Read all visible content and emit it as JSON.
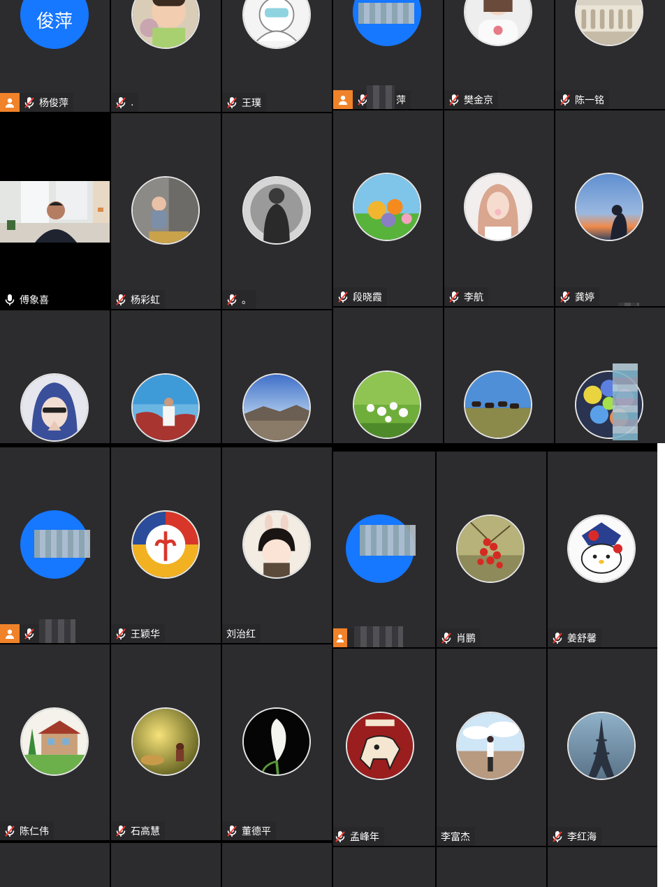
{
  "colors": {
    "tile": "#2c2c2e",
    "host_badge": "#f0822a",
    "blue_avatar": "#1677ff"
  },
  "avatar_initials": {
    "t0": "俊萍"
  },
  "tiles": {
    "t0": {
      "name": "杨俊萍"
    },
    "t1": {
      "name": "."
    },
    "t2": {
      "name": "王璞"
    },
    "t3": {
      "name": "萍"
    },
    "t4": {
      "name": "樊金京"
    },
    "t5": {
      "name": "陈一铭"
    },
    "t6": {
      "name": "傅象喜"
    },
    "t7": {
      "name": "杨彩虹"
    },
    "t8": {
      "name": "。"
    },
    "t9": {
      "name": "段晓霞"
    },
    "t10": {
      "name": "李航"
    },
    "t11": {
      "name": "龚婷"
    },
    "t19": {
      "name": "王颖华"
    },
    "t20": {
      "name": "刘治红"
    },
    "t22": {
      "name": "肖鹏"
    },
    "t23": {
      "name": "姜舒馨"
    },
    "t24": {
      "name": "陈仁伟"
    },
    "t25": {
      "name": "石高慧"
    },
    "t26": {
      "name": "董德平"
    },
    "t27": {
      "name": "孟峰年"
    },
    "t28": {
      "name": "李富杰"
    },
    "t29": {
      "name": "李红海"
    }
  }
}
